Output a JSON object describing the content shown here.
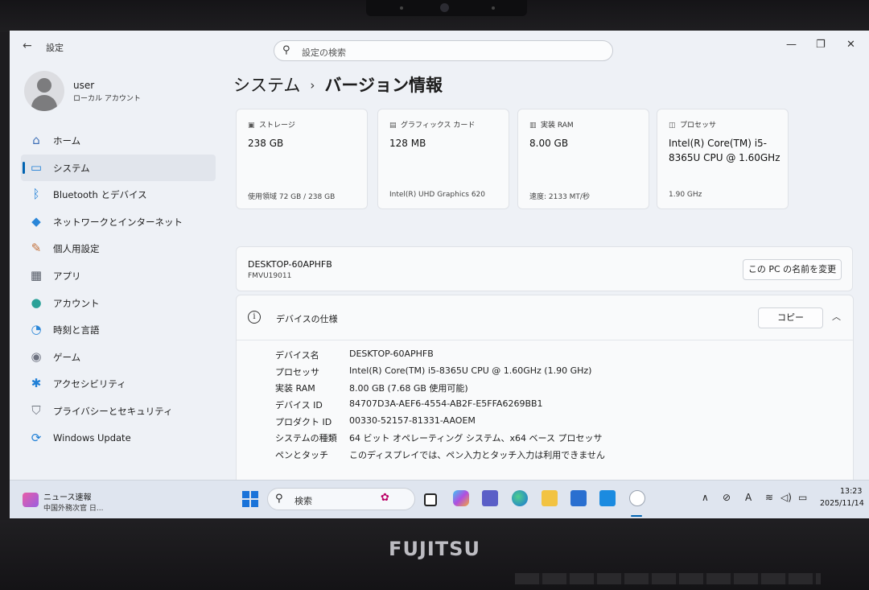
{
  "window": {
    "back_glyph": "←",
    "app_title": "設定",
    "search_placeholder": "設定の検索",
    "minimize_glyph": "—",
    "maximize_glyph": "❐",
    "close_glyph": "✕"
  },
  "user": {
    "name": "user",
    "account_type": "ローカル アカウント"
  },
  "sidebar": {
    "items": [
      {
        "label": "ホーム",
        "icon": "home-icon",
        "glyph": "⌂",
        "color": "#3d6fb6"
      },
      {
        "label": "システム",
        "icon": "system-icon",
        "glyph": "▭",
        "color": "#1f7fd6",
        "active": true
      },
      {
        "label": "Bluetooth とデバイス",
        "icon": "bluetooth-icon",
        "glyph": "ᛒ",
        "color": "#1f7fd6"
      },
      {
        "label": "ネットワークとインターネット",
        "icon": "network-icon",
        "glyph": "◆",
        "color": "#2a86d8"
      },
      {
        "label": "個人用設定",
        "icon": "personalize-icon",
        "glyph": "✎",
        "color": "#c2703a"
      },
      {
        "label": "アプリ",
        "icon": "apps-icon",
        "glyph": "▦",
        "color": "#555b66"
      },
      {
        "label": "アカウント",
        "icon": "account-icon",
        "glyph": "●",
        "color": "#2aa198"
      },
      {
        "label": "時刻と言語",
        "icon": "time-language-icon",
        "glyph": "◔",
        "color": "#2a86d8"
      },
      {
        "label": "ゲーム",
        "icon": "gaming-icon",
        "glyph": "◉",
        "color": "#6d7280"
      },
      {
        "label": "アクセシビリティ",
        "icon": "accessibility-icon",
        "glyph": "✱",
        "color": "#1f7fd6"
      },
      {
        "label": "プライバシーとセキュリティ",
        "icon": "privacy-shield-icon",
        "glyph": "⛉",
        "color": "#707680"
      },
      {
        "label": "Windows Update",
        "icon": "windows-update-icon",
        "glyph": "⟳",
        "color": "#1f7fd6"
      }
    ]
  },
  "breadcrumb": {
    "parent": "システム",
    "separator": "›",
    "current": "バージョン情報"
  },
  "cards": [
    {
      "label": "ストレージ",
      "icon": "storage-icon",
      "glyph": "▣",
      "value": "238 GB",
      "sub": "使用領域 72 GB / 238 GB"
    },
    {
      "label": "グラフィックス カード",
      "icon": "graphics-card-icon",
      "glyph": "▤",
      "value": "128 MB",
      "sub": "Intel(R) UHD Graphics 620"
    },
    {
      "label": "実装 RAM",
      "icon": "ram-icon",
      "glyph": "▥",
      "value": "8.00 GB",
      "sub": "速度: 2133 MT/秒"
    },
    {
      "label": "プロセッサ",
      "icon": "processor-icon",
      "glyph": "◫",
      "value": "Intel(R) Core(TM) i5-8365U CPU @ 1.60GHz",
      "sub": "1.90 GHz"
    }
  ],
  "pc": {
    "name": "DESKTOP-60APHFB",
    "model": "FMVU19011",
    "rename_button": "この PC の名前を変更"
  },
  "specs": {
    "title": "デバイスの仕様",
    "copy_button": "コピー",
    "collapse_glyph": "︿",
    "rows": [
      {
        "key": "デバイス名",
        "value": "DESKTOP-60APHFB"
      },
      {
        "key": "プロセッサ",
        "value": "Intel(R) Core(TM) i5-8365U CPU @ 1.60GHz   (1.90 GHz)"
      },
      {
        "key": "実装 RAM",
        "value": "8.00 GB (7.68 GB 使用可能)"
      },
      {
        "key": "デバイス ID",
        "value": "84707D3A-AEF6-4554-AB2F-E5FFA6269BB1"
      },
      {
        "key": "プロダクト ID",
        "value": "00330-52157-81331-AAOEM"
      },
      {
        "key": "システムの種類",
        "value": "64 ビット オペレーティング システム、x64 ベース プロセッサ"
      },
      {
        "key": "ペンとタッチ",
        "value": "このディスプレイでは、ペン入力とタッチ入力は利用できません"
      }
    ]
  },
  "taskbar": {
    "news_title": "ニュース速報",
    "news_text": "中国外務次官 日...",
    "search_placeholder": "検索",
    "time": "13:23",
    "date": "2025/11/14",
    "tray": {
      "chevron": "∧",
      "input_mode": "A",
      "wifi": "≋",
      "volume": "◁)",
      "battery": "▭"
    }
  },
  "device": {
    "brand": "FUJITSU"
  }
}
